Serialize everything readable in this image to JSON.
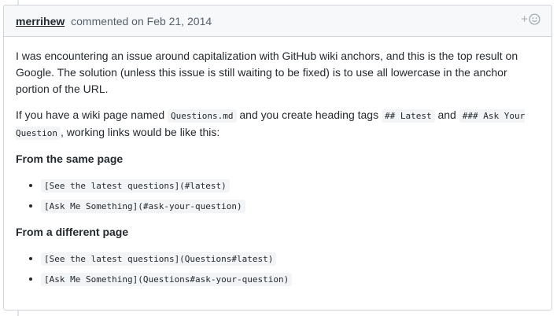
{
  "comment": {
    "author": "merrihew",
    "meta": "commented on Feb 21, 2014",
    "reaction_icon": "smiley-add-icon",
    "paragraph1": "I was encountering an issue around capitalization with GitHub wiki anchors, and this is the top result on Google. The solution (unless this issue is still waiting to be fixed) is to use all lowercase in the anchor portion of the URL.",
    "paragraph2": {
      "t1": "If you have a wiki page named ",
      "c1": "Questions.md",
      "t2": " and you create heading tags ",
      "c2": "## Latest",
      "t3": " and ",
      "c3": "### Ask Your Question",
      "t4": ", working links would be like this:"
    },
    "same_page_label": "From the same page",
    "same_page_links": [
      "[See the latest questions](#latest)",
      "[Ask Me Something](#ask-your-question)"
    ],
    "diff_page_label": "From a different page",
    "diff_page_links": [
      "[See the latest questions](Questions#latest)",
      "[Ask Me Something](Questions#ask-your-question)"
    ]
  }
}
